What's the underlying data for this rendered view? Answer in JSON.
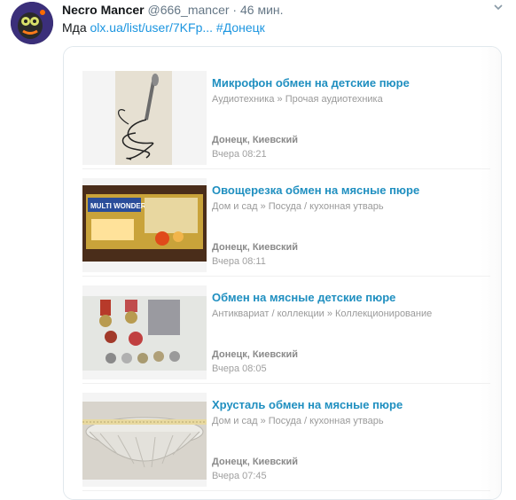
{
  "tweet": {
    "author_name": "Necro Mancer",
    "author_handle": "@666_mancer",
    "separator": "·",
    "time": "46 мин.",
    "text_prefix": "Мда",
    "link_text": "olx.ua/list/user/7KFp...",
    "hashtag": "#Донецк"
  },
  "card": {
    "listings": [
      {
        "title": "Микрофон обмен на детские пюре",
        "category": "Аудиотехника » Прочая аудиотехника",
        "location": "Донецк, Киевский",
        "time": "Вчера 08:21"
      },
      {
        "title": "Овощерезка обмен на мясные пюре",
        "category": "Дом и сад » Посуда / кухонная утварь",
        "location": "Донецк, Киевский",
        "time": "Вчера 08:11",
        "image_text": "MULTI WONDER"
      },
      {
        "title": "Обмен на мясные детские пюре",
        "category": "Антиквариат / коллекции » Коллекционирование",
        "location": "Донецк, Киевский",
        "time": "Вчера 08:05"
      },
      {
        "title": "Хрусталь обмен на мясные пюре",
        "category": "Дом и сад » Посуда / кухонная утварь",
        "location": "Донецк, Киевский",
        "time": "Вчера 07:45"
      }
    ]
  },
  "icons": {
    "more": "chevron-down-icon"
  }
}
